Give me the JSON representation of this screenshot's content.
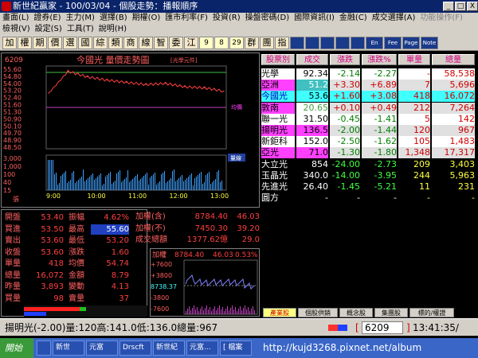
{
  "window": {
    "title": "新世紀贏家 - 100/03/04 - 個股走勢：播報順序",
    "min": "_",
    "max": "□",
    "close": "X"
  },
  "menu": {
    "row1": [
      "畫面(L)",
      "證券(E)",
      "主力(M)",
      "選擇(B)",
      "期權(O)",
      "匯市利率(F)",
      "投資(R)",
      "操盤密碼(D)",
      "國際資訊(I)",
      "金融(C)",
      "成交選擇(A)",
      "功能操作(F)"
    ],
    "row2": [
      "檢視(V)",
      "設定(S)",
      "工具(T)",
      "說明(H)"
    ]
  },
  "toolbar": {
    "items": [
      "加",
      "權",
      "期",
      "價",
      "選",
      "國",
      "綜",
      "類",
      "商",
      "線",
      "智",
      "委",
      "江",
      "9",
      "8",
      "29",
      "群",
      "團",
      "指",
      "",
      "",
      "",
      "",
      "",
      "En",
      "Fee",
      "Page",
      "Note"
    ]
  },
  "chart": {
    "code": "6209",
    "title": "今國光 量價走勢圖",
    "subtitle": "[光學元件]",
    "unit": "張",
    "price_ticks": [
      "55.60",
      "54.80",
      "54.00",
      "53.20",
      "52.40",
      "51.60",
      "51.30",
      "50.90",
      "50.10",
      "49.70",
      "48.90",
      "48.50"
    ],
    "vol_ticks": [
      "3,000",
      "1,000",
      "100",
      "40",
      "15"
    ],
    "time_ticks": [
      "9:00",
      "10:00",
      "11:00",
      "12:00",
      "13:00"
    ],
    "badge_avg": "均價",
    "badge_vol": "量線",
    "chart_data": {
      "type": "line",
      "x": [
        "9:00",
        "9:30",
        "10:00",
        "10:30",
        "11:00",
        "11:30",
        "12:00",
        "12:30",
        "13:00",
        "13:30"
      ],
      "series": [
        {
          "name": "今國光",
          "values": [
            53.4,
            55.4,
            54.9,
            54.6,
            54.4,
            54.2,
            54.3,
            54.0,
            53.9,
            53.6
          ]
        }
      ],
      "ylim": [
        48.5,
        55.6
      ]
    }
  },
  "quote": {
    "rows": [
      {
        "l1": "開盤",
        "v1": "53.40",
        "l2": "振幅",
        "v2": "4.62%",
        "l3": "加權(含)",
        "v3": "8784.40",
        "v4": "46.03"
      },
      {
        "l1": "買進",
        "v1": "53.50",
        "l2": "最高",
        "v2": "55.60",
        "l3": "加權(不)",
        "v3": "7450.30",
        "v4": "39.20"
      },
      {
        "l1": "賣出",
        "v1": "53.60",
        "l2": "最低",
        "v2": "53.20",
        "l3": "成交總額",
        "v3": "1377.62億",
        "v4": "29.0"
      },
      {
        "l1": "收盤",
        "v1": "53.60",
        "l2": "漲跌",
        "v2": "1.60",
        "l3": "",
        "v3": "",
        "v4": ""
      },
      {
        "l1": "單量",
        "v1": "418",
        "l2": "均價",
        "v2": "54.74",
        "l3": "",
        "v3": "",
        "v4": ""
      },
      {
        "l1": "總量",
        "v1": "16,072",
        "l2": "金額",
        "v2": "8.79",
        "l3": "",
        "v3": "",
        "v4": ""
      },
      {
        "l1": "昨量",
        "v1": "3,893",
        "l2": "變動",
        "v2": "4.13",
        "l3": "",
        "v3": "",
        "v4": ""
      },
      {
        "l1": "買量",
        "v1": "98",
        "l2": "賣量",
        "v2": "37",
        "l3": "",
        "v3": "",
        "v4": ""
      }
    ]
  },
  "index_mini": {
    "label": "加權",
    "value": "8784.40",
    "change": "46.03",
    "pct": "0.53%",
    "ticks": [
      "+7600",
      "+3800",
      "8738.37",
      "-3800",
      "-7600"
    ]
  },
  "stock_table": {
    "headers": [
      "股票別",
      "成交",
      "漲跌",
      "漲跌%",
      "單量",
      "總量"
    ],
    "rows": [
      {
        "name": "光學",
        "price": "92.34",
        "chg": "-2.14",
        "pct": "-2.27",
        "vol": "-",
        "total": "58,538"
      },
      {
        "name": "亞洲",
        "price": "51.2",
        "chg": "+3.30",
        "pct": "+6.89",
        "vol": "7",
        "total": "5,696"
      },
      {
        "name": "今國光",
        "price": "53.6",
        "chg": "+1.60",
        "pct": "+3.08",
        "vol": "418",
        "total": "16,072"
      },
      {
        "name": "敦南",
        "price": "20.65",
        "chg": "+0.10",
        "pct": "+0.49",
        "vol": "212",
        "total": "7,264"
      },
      {
        "name": "聯一光",
        "price": "31.50",
        "chg": "-0.45",
        "pct": "-1.41",
        "vol": "5",
        "total": "142"
      },
      {
        "name": "揚明光",
        "price": "136.5",
        "chg": "-2.00",
        "pct": "-1.44",
        "vol": "120",
        "total": "967"
      },
      {
        "name": "新鉅科",
        "price": "152.0",
        "chg": "-2.50",
        "pct": "-1.62",
        "vol": "105",
        "total": "1,483"
      },
      {
        "name": "亞光",
        "price": "71.0",
        "chg": "-1.30",
        "pct": "-1.80",
        "vol": "1,348",
        "total": "17,317"
      },
      {
        "name": "大立光",
        "price": "854",
        "chg": "-24.00",
        "pct": "-2.73",
        "vol": "209",
        "total": "3,403"
      },
      {
        "name": "玉晶光",
        "price": "340.0",
        "chg": "-14.00",
        "pct": "-3.95",
        "vol": "244",
        "total": "5,963"
      },
      {
        "name": "先進光",
        "price": "26.40",
        "chg": "-1.45",
        "pct": "-5.21",
        "vol": "11",
        "total": "231"
      },
      {
        "name": "圓方",
        "price": "-",
        "chg": "-",
        "pct": "-",
        "vol": "-",
        "total": "-"
      }
    ]
  },
  "tabs": [
    "產業股",
    "個股供銷",
    "概念股",
    "集團股",
    "標的/權證"
  ],
  "footer": {
    "ticker": "揚明光(-2.00)量:120高:141.0低:136.0總量:967",
    "code_input": "6209",
    "time": "13:41:35/"
  },
  "taskbar": {
    "start": "開始",
    "items": [
      "",
      "新世",
      "元富",
      "Drscft",
      "新世紀",
      "元富...",
      "[ 檔案"
    ],
    "watermark": "http://kujd3268.pixnet.net/album"
  },
  "colors": {
    "accent": "#0a246a",
    "up": "#ff4040",
    "down": "#40ff40",
    "bg": "#000000"
  }
}
